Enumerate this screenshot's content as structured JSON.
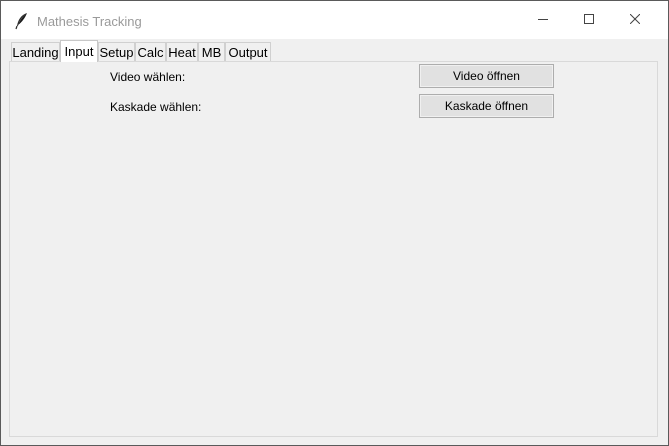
{
  "window": {
    "title": "Mathesis Tracking",
    "app_icon": "feather-icon"
  },
  "window_controls": {
    "minimize_icon": "minimize-icon",
    "maximize_icon": "maximize-icon",
    "close_icon": "close-icon"
  },
  "tabs": [
    {
      "label": "Landing",
      "selected": false
    },
    {
      "label": "Input",
      "selected": true
    },
    {
      "label": "Setup",
      "selected": false
    },
    {
      "label": "Calc",
      "selected": false
    },
    {
      "label": "Heat",
      "selected": false
    },
    {
      "label": "MB",
      "selected": false
    },
    {
      "label": "Output",
      "selected": false
    }
  ],
  "input_tab": {
    "video_label": "Video wählen:",
    "video_button": "Video öffnen",
    "cascade_label": "Kaskade wählen:",
    "cascade_button": "Kaskade öffnen"
  }
}
